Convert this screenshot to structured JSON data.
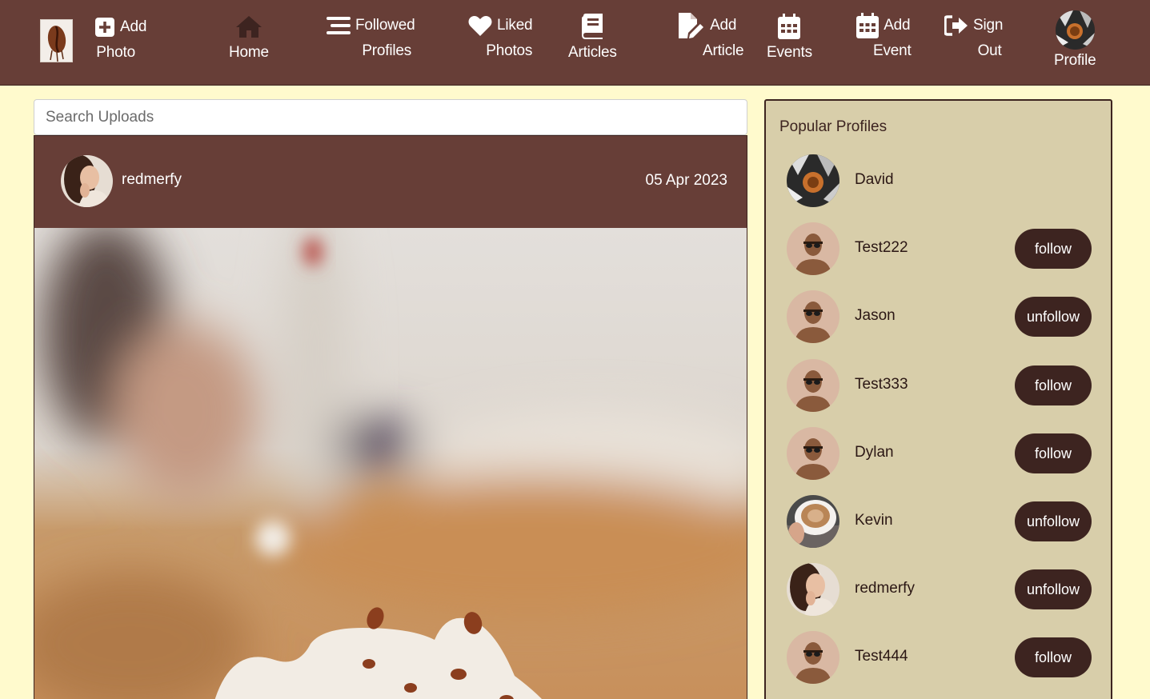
{
  "nav": {
    "add_photo": {
      "line1": "Add",
      "line2": "Photo"
    },
    "home": {
      "label": "Home"
    },
    "followed_profiles": {
      "line1": "Followed",
      "line2": "Profiles"
    },
    "liked_photos": {
      "line1": "Liked",
      "line2": "Photos"
    },
    "articles": {
      "label": "Articles"
    },
    "add_article": {
      "line1": "Add",
      "line2": "Article"
    },
    "events": {
      "label": "Events"
    },
    "add_event": {
      "line1": "Add",
      "line2": "Event"
    },
    "sign_out": {
      "line1": "Sign",
      "line2": "Out"
    },
    "profile": {
      "label": "Profile"
    },
    "icons": [
      "logo-coffee-bean",
      "plus-square-icon",
      "home-icon",
      "stream-icon",
      "heart-icon",
      "book-icon",
      "file-edit-icon",
      "calendar-icon",
      "calendar-plus-icon",
      "sign-out-icon",
      "profile-avatar"
    ]
  },
  "search": {
    "placeholder": "Search Uploads",
    "value": ""
  },
  "post": {
    "username": "redmerfy",
    "date": "05 Apr 2023"
  },
  "sidebar": {
    "title": "Popular Profiles",
    "profiles": [
      {
        "name": "David",
        "button": "",
        "avatar": "photo-dark"
      },
      {
        "name": "Test222",
        "button": "follow",
        "avatar": "default"
      },
      {
        "name": "Jason",
        "button": "unfollow",
        "avatar": "default"
      },
      {
        "name": "Test333",
        "button": "follow",
        "avatar": "default"
      },
      {
        "name": "Dylan",
        "button": "follow",
        "avatar": "default"
      },
      {
        "name": "Kevin",
        "button": "unfollow",
        "avatar": "photo-coffee"
      },
      {
        "name": "redmerfy",
        "button": "unfollow",
        "avatar": "photo-woman"
      },
      {
        "name": "Test444",
        "button": "follow",
        "avatar": "default"
      }
    ]
  },
  "colors": {
    "page_bg": "#fffacd",
    "nav_bg": "#673e37",
    "sidebar_bg": "#d8ceaa",
    "button_bg": "#3d2420"
  }
}
